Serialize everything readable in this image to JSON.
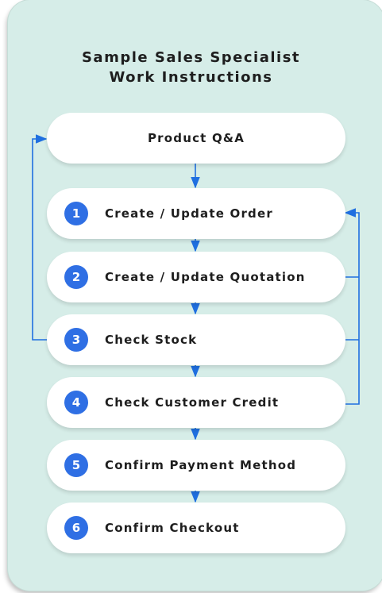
{
  "header": {
    "title_line1": "Sample Sales Specialist",
    "title_line2": "Work Instructions"
  },
  "steps": [
    {
      "number": "",
      "label": "Product Q&A"
    },
    {
      "number": "1",
      "label": "Create / Update Order"
    },
    {
      "number": "2",
      "label": "Create / Update Quotation"
    },
    {
      "number": "3",
      "label": "Check Stock"
    },
    {
      "number": "4",
      "label": "Check Customer Credit"
    },
    {
      "number": "5",
      "label": "Confirm Payment Method"
    },
    {
      "number": "6",
      "label": "Confirm Checkout"
    }
  ],
  "colors": {
    "panel": "#d6ede8",
    "accent": "#2f6fe4",
    "arrow": "#1f6fe0"
  }
}
